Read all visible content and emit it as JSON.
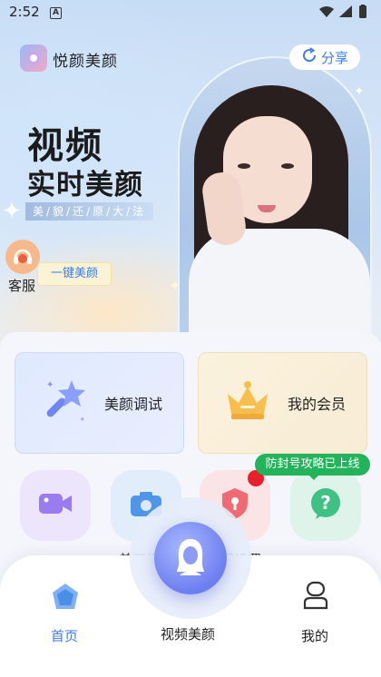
{
  "status_bar": {
    "time": "2:52",
    "notification_letter": "A"
  },
  "header": {
    "app_name": "悦颜美颜",
    "share_label": "分享"
  },
  "hero": {
    "title_line1": "视频",
    "title_line2": "实时美颜",
    "tagline": "美/貌/还/原/大/法",
    "customer_service_label": "客服",
    "one_key_beauty_label": "一键美颜"
  },
  "cards": [
    {
      "label": "美颜调试",
      "icon": "magic-wand-icon"
    },
    {
      "label": "我的会员",
      "icon": "crown-icon"
    }
  ],
  "features": [
    {
      "label": "",
      "icon": "video-camera-icon"
    },
    {
      "label": "美颜相",
      "icon": "camera-icon"
    },
    {
      "label": "眼设置",
      "icon": "shield-icon"
    },
    {
      "label": "",
      "icon": "question-icon"
    }
  ],
  "tooltip": {
    "text": "防封号攻略已上线"
  },
  "bottom_nav": {
    "home_label": "首页",
    "center_label": "视频美颜",
    "profile_label": "我的"
  },
  "colors": {
    "accent": "#3f7bea",
    "tooltip_green": "#22b35b",
    "badge_red": "#e8202a"
  }
}
